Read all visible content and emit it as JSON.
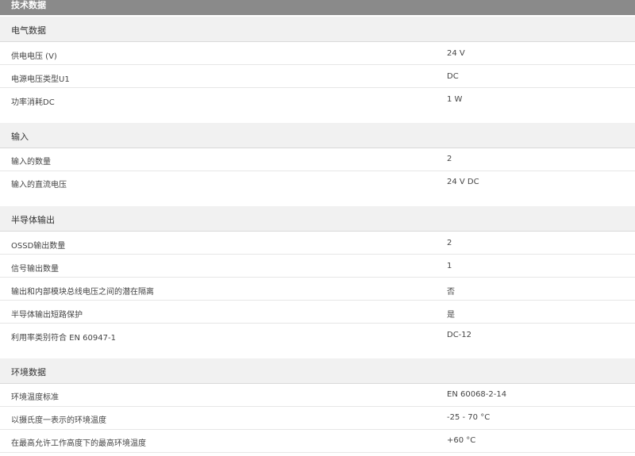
{
  "header": {
    "title": "技术数据"
  },
  "sections": [
    {
      "title": "电气数据",
      "rows": [
        {
          "label": "供电电压 (V)",
          "value": "24  V"
        },
        {
          "label": "电源电压类型U1",
          "value": "DC"
        },
        {
          "label": "功率消耗DC",
          "value": "1  W"
        }
      ]
    },
    {
      "title": "输入",
      "rows": [
        {
          "label": "输入的数量",
          "value": "2"
        },
        {
          "label": "输入的直流电压",
          "value": "24 V DC"
        }
      ]
    },
    {
      "title": "半导体输出",
      "rows": [
        {
          "label": "OSSD输出数量",
          "value": "2"
        },
        {
          "label": "信号输出数量",
          "value": "1"
        },
        {
          "label": "输出和内部模块总线电压之间的潜在隔离",
          "value": "否"
        },
        {
          "label": "半导体输出短路保护",
          "value": "是"
        },
        {
          "label": "利用率类别符合 EN 60947-1",
          "value": "DC-12"
        }
      ]
    },
    {
      "title": "环境数据",
      "rows": [
        {
          "label": "环境温度标准",
          "value": "EN 60068-2-14"
        },
        {
          "label": "以摄氏度一表示的环境温度",
          "value": "-25 - 70  °C"
        },
        {
          "label": "在最高允许工作高度下的最高环境温度",
          "value": "+60 °C"
        }
      ]
    }
  ]
}
